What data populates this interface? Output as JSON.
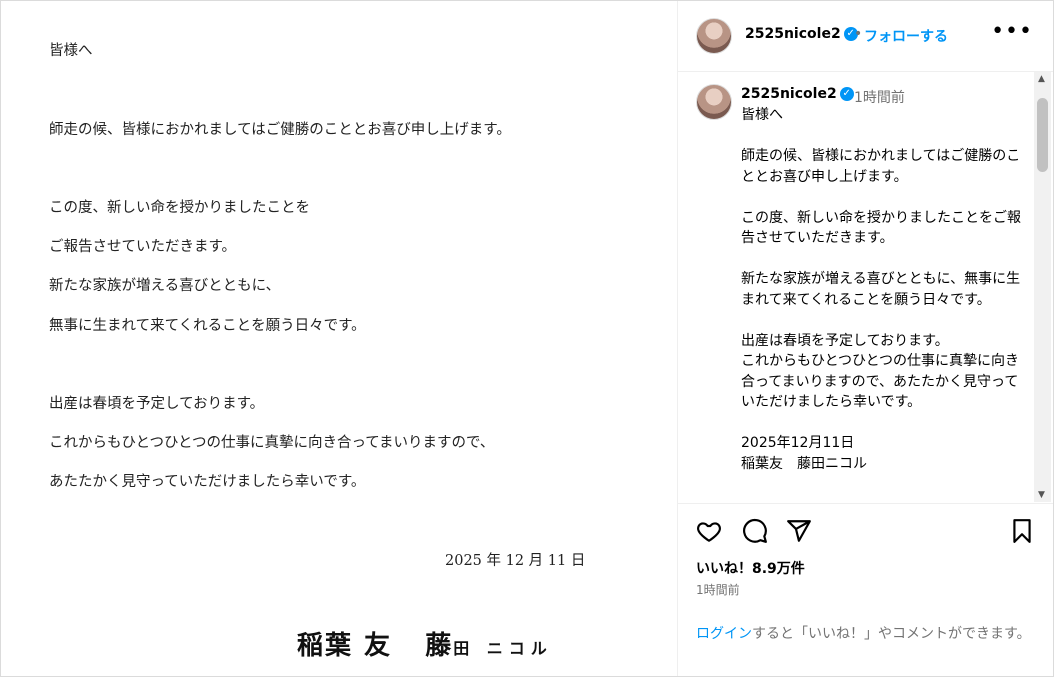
{
  "letter": {
    "lines": [
      "皆様へ",
      "師走の候、皆様におかれましてはご健勝のこととお喜び申し上げます。",
      "この度、新しい命を授かりましたことを",
      "ご報告させていただきます。",
      "新たな家族が増える喜びとともに、",
      "無事に生まれて来てくれることを願う日々です。",
      "出産は春頃を予定しております。",
      "これからもひとつひとつの仕事に真摯に向き合ってまいりますので、",
      "あたたかく見守っていただけましたら幸いです。"
    ],
    "date": "2025 年 12 月 11 日",
    "signature_a": "稲葉 友",
    "signature_b": "藤",
    "signature_c": "田 ニコル"
  },
  "header": {
    "username": "2525nicole2",
    "verified_icon": "verified-badge-icon",
    "separator": "•",
    "follow_label": "フォローする",
    "more_icon": "more-options-icon",
    "more_glyph": "•••"
  },
  "caption": {
    "username": "2525nicole2",
    "time": "1時間前",
    "body": "皆様へ\n\n師走の候、皆様におかれましてはご健勝のこととお喜び申し上げます。\n\nこの度、新しい命を授かりましたことをご報告させていただきます。\n\n新たな家族が増える喜びとともに、無事に生まれて来てくれることを願う日々です。\n\n出産は春頃を予定しております。\nこれからもひとつひとつの仕事に真摯に向き合ってまいりますので、あたたかく見守っていただけましたら幸いです。\n\n2025年12月11日\n稲葉友　藤田ニコル"
  },
  "actions": {
    "likes": "いいね！8.9万件",
    "time": "1時間前",
    "login_link": "ログイン",
    "login_text": "すると「いいね！」やコメントができます。"
  },
  "colors": {
    "accent": "#0095f6",
    "muted": "#737373"
  }
}
